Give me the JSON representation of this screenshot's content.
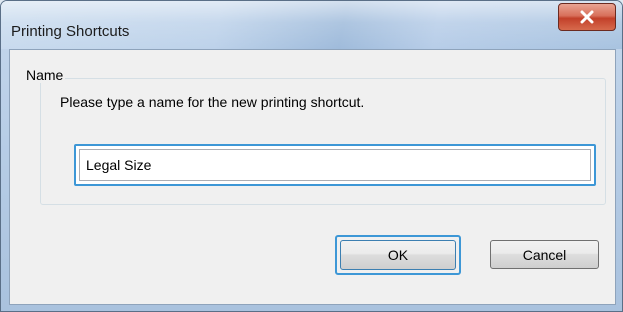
{
  "window": {
    "title": "Printing Shortcuts",
    "close_icon": "close-x-icon",
    "close_color": "#c2402a"
  },
  "group": {
    "legend": "Name",
    "prompt": "Please type a name for the new printing shortcut."
  },
  "name_input": {
    "value": "Legal Size"
  },
  "buttons": {
    "ok_label": "OK",
    "cancel_label": "Cancel"
  },
  "colors": {
    "focus_ring": "#3d97d6",
    "client_bg": "#f0f0f0"
  }
}
